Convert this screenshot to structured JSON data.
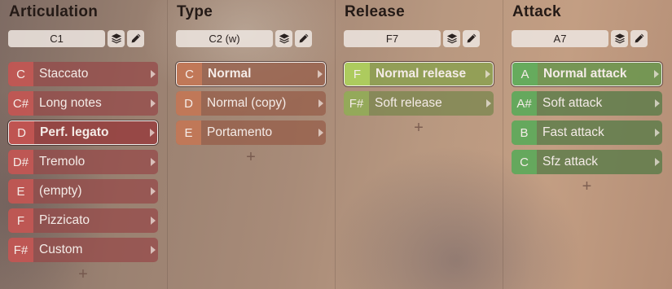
{
  "columns": [
    {
      "title": "Articulation",
      "key": "C1",
      "theme": "red",
      "items": [
        {
          "note": "C",
          "label": "Staccato"
        },
        {
          "note": "C#",
          "label": "Long notes"
        },
        {
          "note": "D",
          "label": "Perf. legato",
          "selected": true
        },
        {
          "note": "D#",
          "label": "Tremolo"
        },
        {
          "note": "E",
          "label": "(empty)"
        },
        {
          "note": "F",
          "label": "Pizzicato"
        },
        {
          "note": "F#",
          "label": "Custom"
        }
      ],
      "add": "+"
    },
    {
      "title": "Type",
      "key": "C2 (w)",
      "theme": "orange",
      "items": [
        {
          "note": "C",
          "label": "Normal",
          "selected": true
        },
        {
          "note": "D",
          "label": "Normal (copy)"
        },
        {
          "note": "E",
          "label": "Portamento"
        }
      ],
      "add": "+"
    },
    {
      "title": "Release",
      "key": "F7",
      "theme": "olive",
      "items": [
        {
          "note": "F",
          "label": "Normal release",
          "selected": true
        },
        {
          "note": "F#",
          "label": "Soft release"
        }
      ],
      "add": "+"
    },
    {
      "title": "Attack",
      "key": "A7",
      "theme": "green",
      "items": [
        {
          "note": "A",
          "label": "Normal attack",
          "selected": true
        },
        {
          "note": "A#",
          "label": "Soft attack"
        },
        {
          "note": "B",
          "label": "Fast attack"
        },
        {
          "note": "C",
          "label": "Sfz attack"
        }
      ],
      "add": "+"
    }
  ],
  "icons": {
    "layers": "layers-icon",
    "edit": "pencil-icon",
    "expand": "chevron-right-icon"
  },
  "colors": {
    "red": "#b85a58",
    "orange": "#b8795c",
    "olive": "#96a55a",
    "green": "#5fa55a"
  }
}
